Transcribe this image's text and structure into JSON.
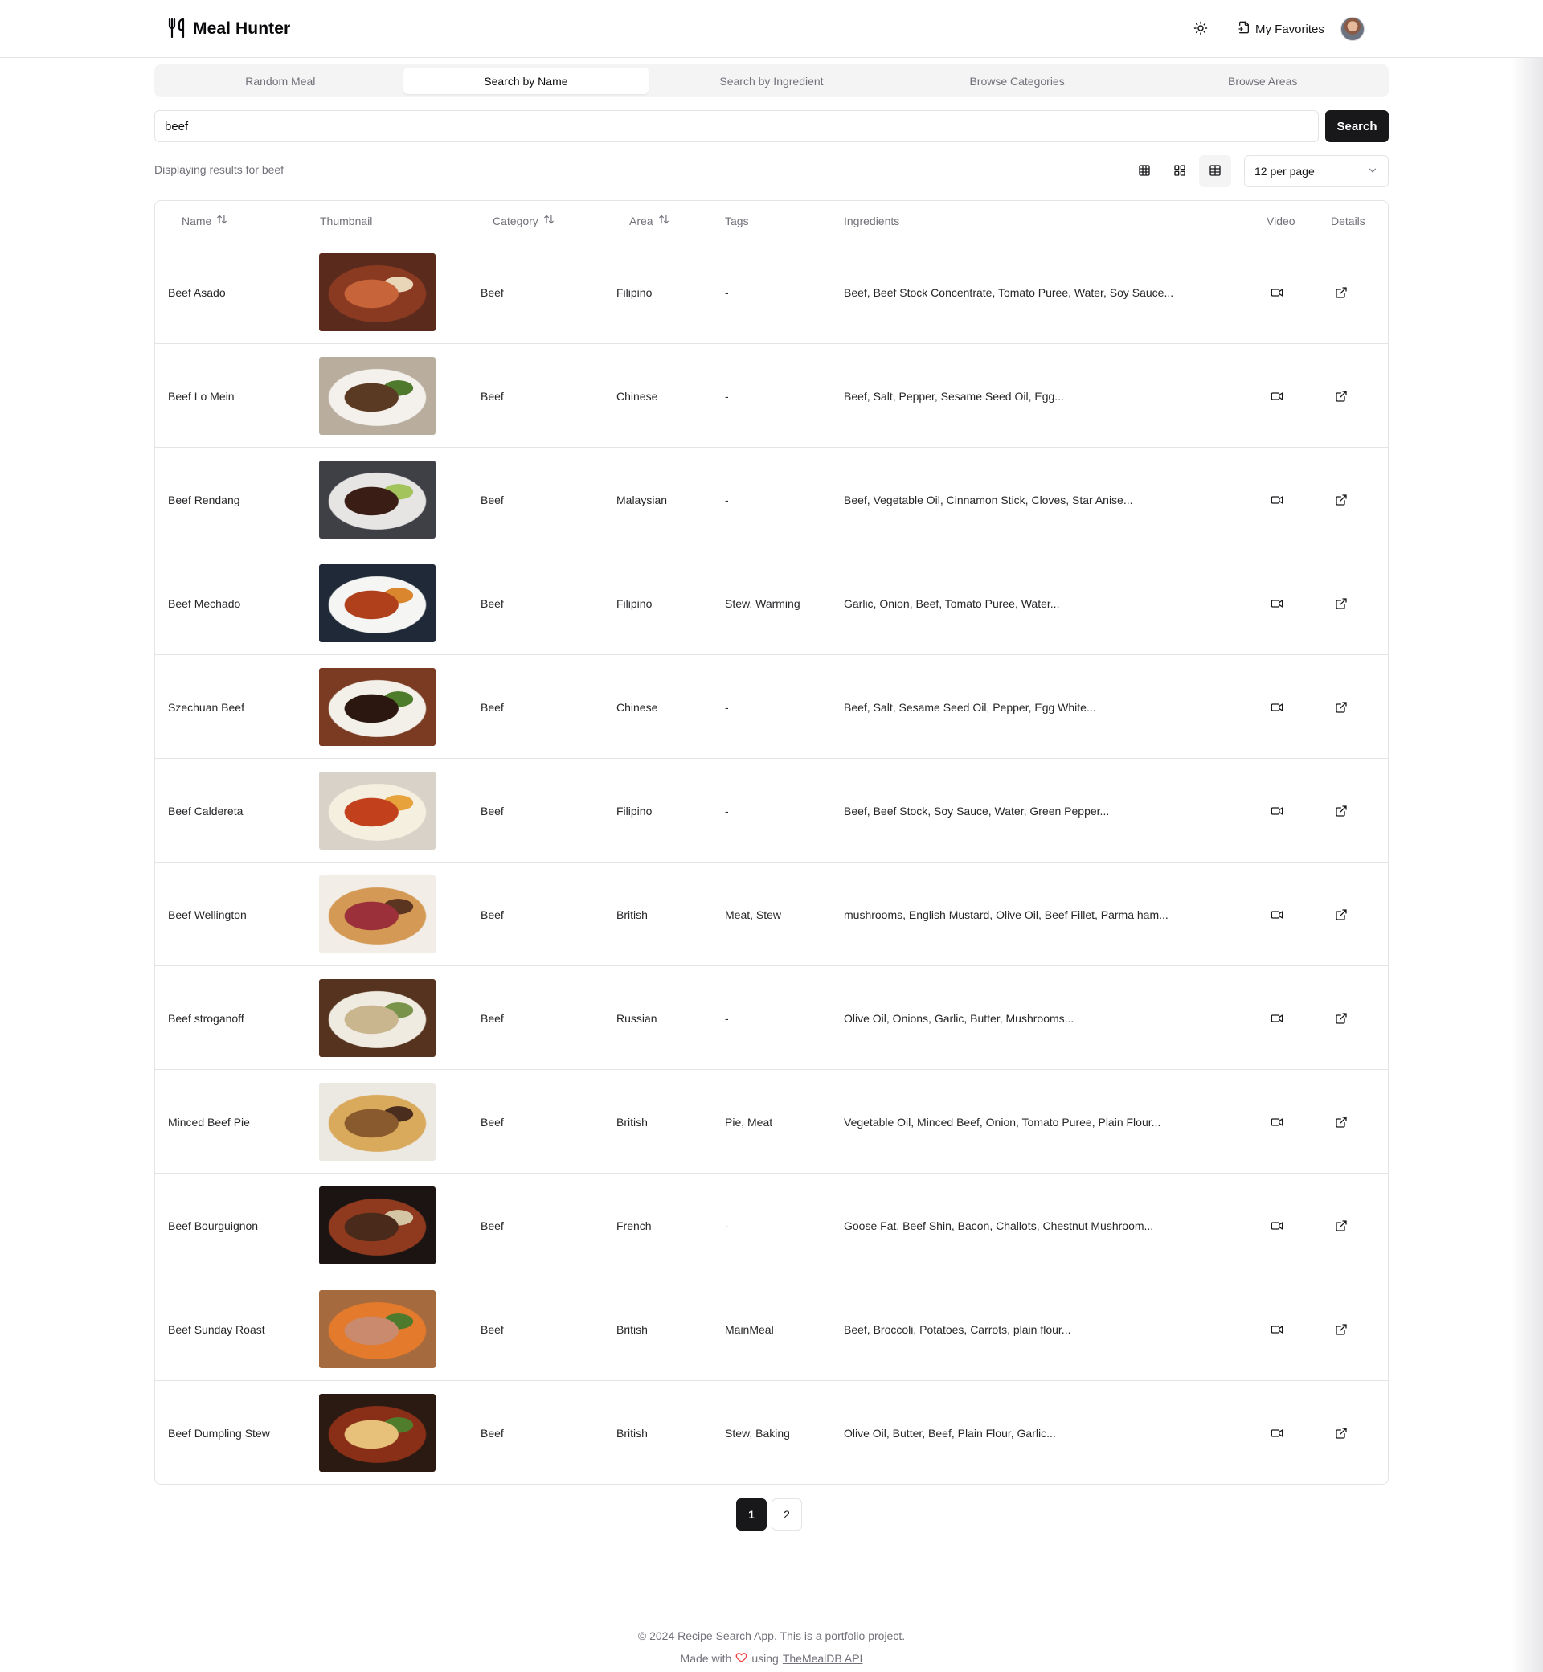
{
  "app": {
    "title": "Meal Hunter",
    "favorites_label": "My Favorites"
  },
  "tabs": [
    {
      "label": "Random Meal",
      "active": false
    },
    {
      "label": "Search by Name",
      "active": true
    },
    {
      "label": "Search by Ingredient",
      "active": false
    },
    {
      "label": "Browse Categories",
      "active": false
    },
    {
      "label": "Browse Areas",
      "active": false
    }
  ],
  "search": {
    "value": "beef",
    "button_label": "Search"
  },
  "results": {
    "text": "Displaying results for beef",
    "per_page": "12 per page",
    "active_view": "table"
  },
  "table": {
    "headers": {
      "name": "Name",
      "thumbnail": "Thumbnail",
      "category": "Category",
      "area": "Area",
      "tags": "Tags",
      "ingredients": "Ingredients",
      "video": "Video",
      "details": "Details"
    },
    "rows": [
      {
        "name": "Beef Asado",
        "category": "Beef",
        "area": "Filipino",
        "tags": "-",
        "ingredients": "Beef, Beef Stock Concentrate, Tomato Puree, Water, Soy Sauce...",
        "colors": [
          "#5a2a1c",
          "#8b3a22",
          "#c8643a",
          "#e9d6b8"
        ]
      },
      {
        "name": "Beef Lo Mein",
        "category": "Beef",
        "area": "Chinese",
        "tags": "-",
        "ingredients": "Beef, Salt, Pepper, Sesame Seed Oil, Egg...",
        "colors": [
          "#b9ae9e",
          "#f4f1ec",
          "#5b3a24",
          "#4f7a2d"
        ]
      },
      {
        "name": "Beef Rendang",
        "category": "Beef",
        "area": "Malaysian",
        "tags": "-",
        "ingredients": "Beef, Vegetable Oil, Cinnamon Stick, Cloves, Star Anise...",
        "colors": [
          "#3f3f46",
          "#e7e5e4",
          "#3a1d14",
          "#a3c45c"
        ]
      },
      {
        "name": "Beef Mechado",
        "category": "Beef",
        "area": "Filipino",
        "tags": "Stew, Warming",
        "ingredients": "Garlic, Onion, Beef, Tomato Puree, Water...",
        "colors": [
          "#1f2937",
          "#f5f5f4",
          "#b0401c",
          "#d9862e"
        ]
      },
      {
        "name": "Szechuan Beef",
        "category": "Beef",
        "area": "Chinese",
        "tags": "-",
        "ingredients": "Beef, Salt, Sesame Seed Oil, Pepper, Egg White...",
        "colors": [
          "#7a3b22",
          "#f3efe9",
          "#2b1610",
          "#4d7c2a"
        ]
      },
      {
        "name": "Beef Caldereta",
        "category": "Beef",
        "area": "Filipino",
        "tags": "-",
        "ingredients": "Beef, Beef Stock, Soy Sauce, Water, Green Pepper...",
        "colors": [
          "#d8d2c8",
          "#f5efe0",
          "#c2411c",
          "#e8a23b"
        ]
      },
      {
        "name": "Beef Wellington",
        "category": "Beef",
        "area": "British",
        "tags": "Meat, Stew",
        "ingredients": "mushrooms, English Mustard, Olive Oil, Beef Fillet, Parma ham...",
        "colors": [
          "#f2ede6",
          "#d49a55",
          "#9b2f3a",
          "#5b3520"
        ]
      },
      {
        "name": "Beef stroganoff",
        "category": "Beef",
        "area": "Russian",
        "tags": "-",
        "ingredients": "Olive Oil, Onions, Garlic, Butter, Mushrooms...",
        "colors": [
          "#56331f",
          "#f0ebe1",
          "#c9b68f",
          "#79934a"
        ]
      },
      {
        "name": "Minced Beef Pie",
        "category": "Beef",
        "area": "British",
        "tags": "Pie, Meat",
        "ingredients": "Vegetable Oil, Minced Beef, Onion, Tomato Puree, Plain Flour...",
        "colors": [
          "#ece8e2",
          "#d9a95c",
          "#8a5a2f",
          "#4a2d1c"
        ]
      },
      {
        "name": "Beef Bourguignon",
        "category": "Beef",
        "area": "French",
        "tags": "-",
        "ingredients": "Goose Fat, Beef Shin, Bacon, Challots, Chestnut Mushroom...",
        "colors": [
          "#1c1412",
          "#8f3a1e",
          "#4a2a1a",
          "#d4c6a5"
        ]
      },
      {
        "name": "Beef Sunday Roast",
        "category": "Beef",
        "area": "British",
        "tags": "MainMeal",
        "ingredients": "Beef, Broccoli, Potatoes, Carrots, plain flour...",
        "colors": [
          "#a66a3f",
          "#e37a2c",
          "#c98a6e",
          "#4d7a2c"
        ]
      },
      {
        "name": "Beef Dumpling Stew",
        "category": "Beef",
        "area": "British",
        "tags": "Stew, Baking",
        "ingredients": "Olive Oil, Butter, Beef, Plain Flour, Garlic...",
        "colors": [
          "#2a1a12",
          "#8a2f17",
          "#e7c07a",
          "#4f7d2c"
        ]
      }
    ]
  },
  "pagination": {
    "pages": [
      "1",
      "2"
    ],
    "current": "1"
  },
  "footer": {
    "copyright": "© 2024 Recipe Search App. This is a portfolio project.",
    "made_with": "Made with",
    "using": "using",
    "link_text": "TheMealDB API"
  },
  "colors": {
    "primary": "#18181b",
    "muted": "#71717a",
    "border": "#e4e4e7",
    "heart": "#ef4444"
  }
}
